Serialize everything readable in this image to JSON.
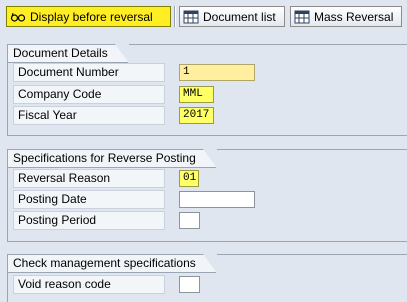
{
  "toolbar": {
    "display_before_reversal": "Display before reversal",
    "document_list": "Document list",
    "mass_reversal": "Mass Reversal"
  },
  "document_details": {
    "title": "Document Details",
    "document_number_label": "Document Number",
    "document_number_value": "1",
    "company_code_label": "Company Code",
    "company_code_value": "MML",
    "fiscal_year_label": "Fiscal Year",
    "fiscal_year_value": "2017"
  },
  "reverse_posting": {
    "title": "Specifications for Reverse Posting",
    "reversal_reason_label": "Reversal Reason",
    "reversal_reason_value": "01",
    "posting_date_label": "Posting Date",
    "posting_date_value": "",
    "posting_period_label": "Posting Period",
    "posting_period_value": ""
  },
  "check_management": {
    "title": "Check management specifications",
    "void_reason_label": "Void reason code",
    "void_reason_value": ""
  },
  "colors": {
    "background": "#dfe6ef",
    "primary_button": "#ffee24",
    "required_field": "#ffff66"
  }
}
